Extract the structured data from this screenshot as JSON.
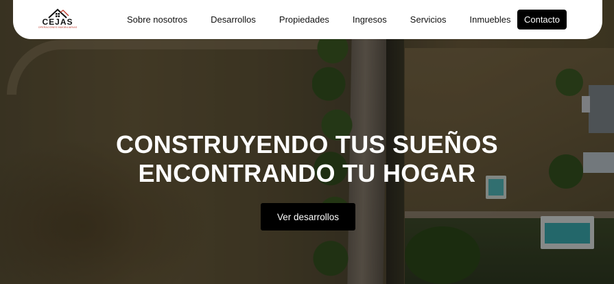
{
  "brand": {
    "name": "CEJAS",
    "tagline": "OPERACIONES INMOBILIARIAS",
    "accent_color": "#c0392b"
  },
  "nav": {
    "items": [
      {
        "label": "Sobre nosotros"
      },
      {
        "label": "Desarrollos"
      },
      {
        "label": "Propiedades"
      },
      {
        "label": "Ingresos"
      },
      {
        "label": "Servicios"
      },
      {
        "label": "Inmuebles"
      }
    ],
    "contact_label": "Contacto"
  },
  "hero": {
    "title_line1": "CONSTRUYENDO TUS SUEÑOS",
    "title_line2": "ENCONTRANDO TU HOGAR",
    "cta_label": "Ver desarrollos",
    "background": "aerial-view-lots-photo"
  }
}
